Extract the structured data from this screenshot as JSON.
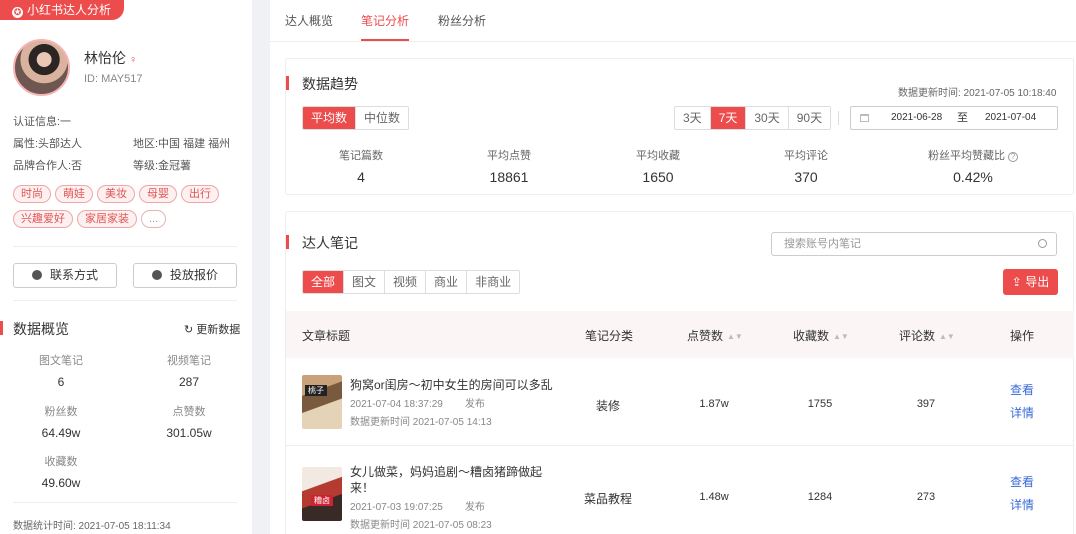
{
  "app": {
    "badge": "小红书达人分析",
    "badge_icon": "✪"
  },
  "profile": {
    "name": "林怡伦",
    "id": "ID: MAY517",
    "cert": "认证信息:一",
    "attr": "属性:头部达人",
    "region": "地区:中国 福建 福州",
    "brand_partner": "品牌合作人:否",
    "level": "等级:金冠薯",
    "tags": [
      "时尚",
      "萌娃",
      "美妆",
      "母婴",
      "出行",
      "兴趣爱好",
      "家居家装",
      "..."
    ],
    "contact_label": "联系方式",
    "quote_label": "投放报价"
  },
  "overview": {
    "title": "数据概览",
    "refresh_label": "更新数据",
    "stats": [
      {
        "label": "图文笔记",
        "value": "6"
      },
      {
        "label": "视频笔记",
        "value": "287"
      },
      {
        "label": "粉丝数",
        "value": "64.49w"
      },
      {
        "label": "点赞数",
        "value": "301.05w"
      },
      {
        "label": "收藏数",
        "value": "49.60w"
      }
    ],
    "footnote": "数据统计时间:  2021-07-05 18:11:34"
  },
  "tabs": [
    "达人概览",
    "笔记分析",
    "粉丝分析"
  ],
  "trend": {
    "title": "数据趋势",
    "updated": "数据更新时间:  2021-07-05 10:18:40",
    "modes": [
      "平均数",
      "中位数"
    ],
    "ranges": [
      "3天",
      "7天",
      "30天",
      "90天"
    ],
    "date_from": "2021-06-28",
    "date_sep": "至",
    "date_to": "2021-07-04",
    "kpis": [
      {
        "label": "笔记篇数",
        "value": "4"
      },
      {
        "label": "平均点赞",
        "value": "18861"
      },
      {
        "label": "平均收藏",
        "value": "1650"
      },
      {
        "label": "平均评论",
        "value": "370"
      },
      {
        "label": "粉丝平均赞藏比",
        "value": "0.42%"
      }
    ]
  },
  "notes": {
    "title": "达人笔记",
    "search_placeholder": "搜索账号内笔记",
    "filters": [
      "全部",
      "图文",
      "视频",
      "商业",
      "非商业"
    ],
    "export_label": "导出",
    "export_icon": "⇪",
    "columns": [
      "文章标题",
      "笔记分类",
      "点赞数",
      "收藏数",
      "评论数",
      "操作"
    ],
    "rows": [
      {
        "title": "狗窝or闺房～初中女生的房间可以多乱",
        "published": "2021-07-04 18:37:29",
        "publish_label": "发布",
        "updated": "数据更新时间   2021-07-05 14:13",
        "category": "装修",
        "likes": "1.87w",
        "saves": "1755",
        "comments": "397",
        "op1": "查看",
        "op2": "详情",
        "thumb_text": "桃子"
      },
      {
        "title": "女儿做菜，妈妈追剧～糟卤猪蹄做起来！",
        "published": "2021-07-03 19:07:25",
        "publish_label": "发布",
        "updated": "数据更新时间   2021-07-05 08:23",
        "category": "菜品教程",
        "likes": "1.48w",
        "saves": "1284",
        "comments": "273",
        "op1": "查看",
        "op2": "详情",
        "thumb_text": "糟卤"
      }
    ]
  }
}
